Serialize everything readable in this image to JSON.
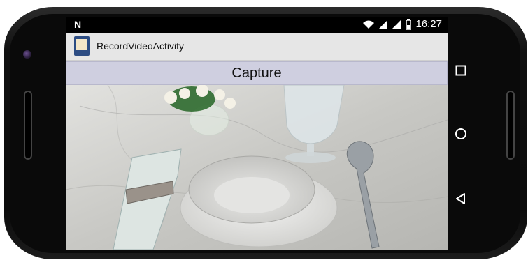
{
  "statusbar": {
    "carrier_icon": "N",
    "time": "16:27"
  },
  "appbar": {
    "title": "RecordVideoActivity"
  },
  "capture": {
    "label": "Capture"
  },
  "navigation": {
    "recents_icon": "square-icon",
    "home_icon": "circle-icon",
    "back_icon": "triangle-icon"
  }
}
